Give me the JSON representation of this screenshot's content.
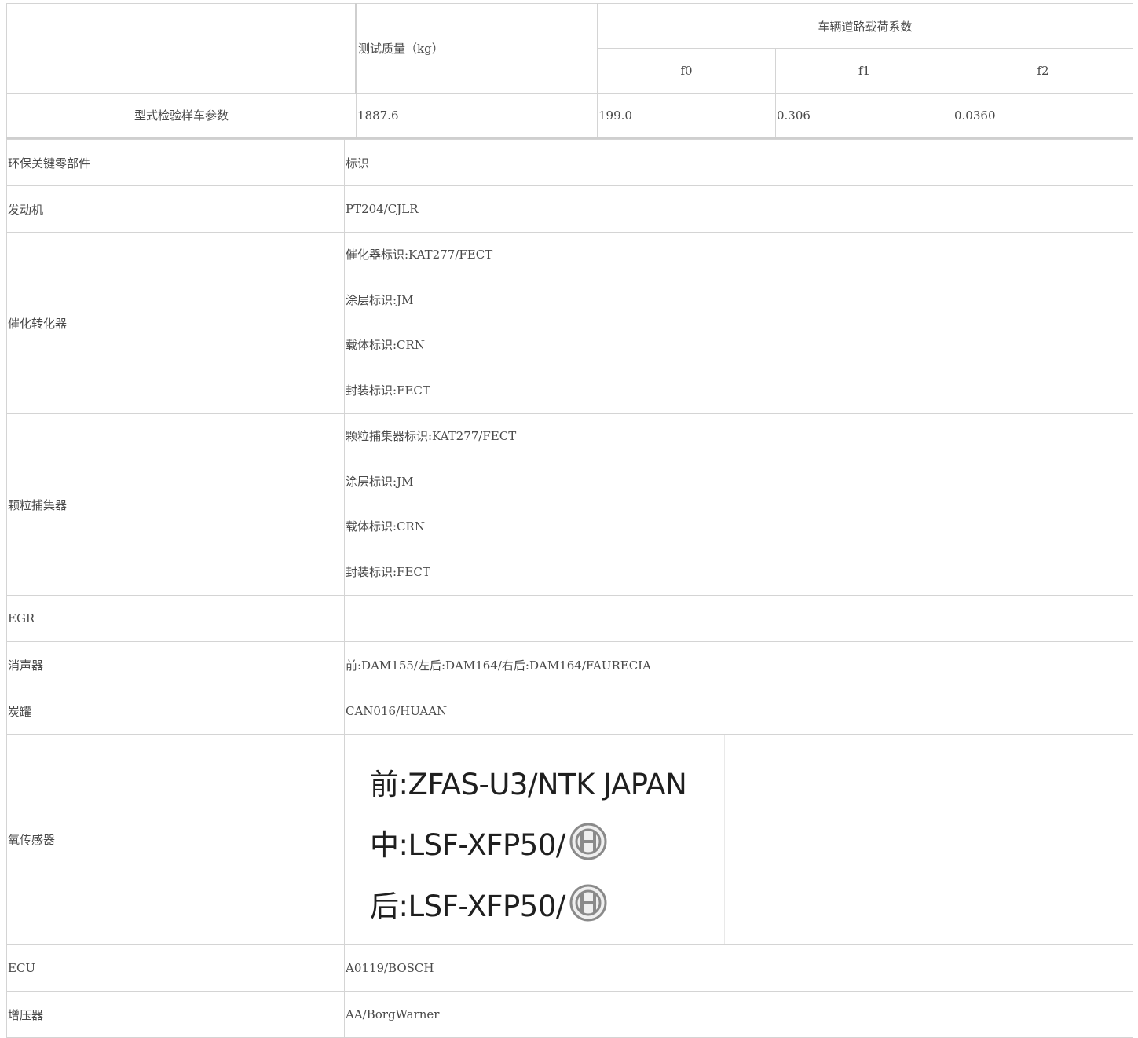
{
  "header": {
    "test_mass_label": "测试质量（kg）",
    "road_load_label": "车辆道路载荷系数",
    "coefficients": [
      "f0",
      "f1",
      "f2"
    ]
  },
  "type_inspection": {
    "label": "型式检验样车参数",
    "test_mass": "1887.6",
    "f0": "199.0",
    "f1": "0.306",
    "f2": "0.0360"
  },
  "parts": {
    "header": {
      "part": "环保关键零部件",
      "mark": "标识"
    },
    "engine": {
      "label": "发动机",
      "value": "PT204/CJLR"
    },
    "catalyst": {
      "label": "催化转化器",
      "lines": [
        "催化器标识:KAT277/FECT",
        "涂层标识:JM",
        "载体标识:CRN",
        "封装标识:FECT"
      ]
    },
    "particulate_filter": {
      "label": "颗粒捕集器",
      "lines": [
        "颗粒捕集器标识:KAT277/FECT",
        "涂层标识:JM",
        "载体标识:CRN",
        "封装标识:FECT"
      ]
    },
    "egr": {
      "label": "EGR",
      "value": ""
    },
    "muffler": {
      "label": "消声器",
      "value": "前:DAM155/左后:DAM164/右后:DAM164/FAURECIA"
    },
    "canister": {
      "label": "炭罐",
      "value": "CAN016/HUAAN"
    },
    "oxygen_sensor": {
      "label": "氧传感器",
      "lines": [
        "前:ZFAS-U3/NTK JAPAN",
        "中:LSF-XFP50/",
        "后:LSF-XFP50/"
      ],
      "logo_icon": "bosch-logo-icon"
    },
    "ecu": {
      "label": "ECU",
      "value": "A0119/BOSCH"
    },
    "turbocharger": {
      "label": "增压器",
      "value": "AA/BorgWarner"
    }
  }
}
